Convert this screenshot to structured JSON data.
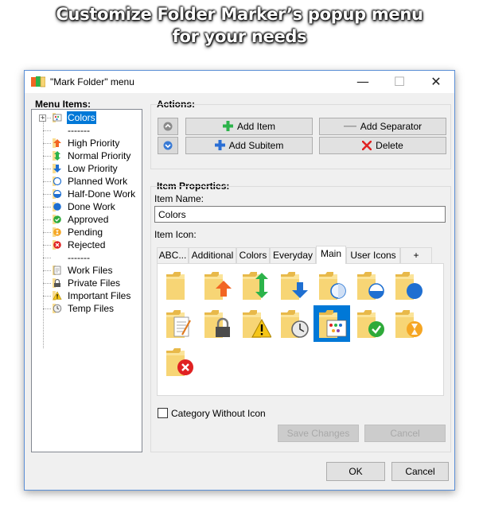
{
  "headline": {
    "line1": "Customize Folder Marker’s popup menu",
    "line2": "for your needs"
  },
  "window": {
    "title": "\"Mark Folder\" menu",
    "minimize_glyph": "—",
    "maximize_glyph": "☐",
    "close_glyph": "✕"
  },
  "menu_items": {
    "label": "Menu Items:",
    "items": [
      {
        "label": "Colors",
        "icon": "palette-icon",
        "selected": true
      },
      {
        "label": "-------",
        "icon": ""
      },
      {
        "label": "High Priority",
        "icon": "up-arrow-icon"
      },
      {
        "label": "Normal Priority",
        "icon": "up-down-arrow-icon"
      },
      {
        "label": "Low Priority",
        "icon": "down-arrow-icon"
      },
      {
        "label": "Planned Work",
        "icon": "empty-circle-icon"
      },
      {
        "label": "Half-Done Work",
        "icon": "half-circle-icon"
      },
      {
        "label": "Done Work",
        "icon": "full-circle-icon"
      },
      {
        "label": "Approved",
        "icon": "check-icon"
      },
      {
        "label": "Pending",
        "icon": "hourglass-icon"
      },
      {
        "label": "Rejected",
        "icon": "reject-icon"
      },
      {
        "label": "-------",
        "icon": ""
      },
      {
        "label": "Work Files",
        "icon": "document-icon"
      },
      {
        "label": "Private Files",
        "icon": "lock-icon"
      },
      {
        "label": "Important Files",
        "icon": "warning-icon"
      },
      {
        "label": "Temp Files",
        "icon": "clock-icon"
      }
    ]
  },
  "actions": {
    "label": "Actions:",
    "add_item": "Add Item",
    "add_separator": "Add Separator",
    "add_subitem": "Add Subitem",
    "delete": "Delete"
  },
  "item_properties": {
    "label": "Item Properties:",
    "item_name_label": "Item Name:",
    "item_name_value": "Colors",
    "item_icon_label": "Item Icon:",
    "tabs": [
      "ABC...",
      "Additional",
      "Colors",
      "Everyday",
      "Main",
      "User Icons",
      "+"
    ],
    "active_tab": "Main",
    "icons": [
      "plain-folder-icon",
      "high-priority-folder-icon",
      "normal-priority-folder-icon",
      "low-priority-folder-icon",
      "planned-folder-icon",
      "half-done-folder-icon",
      "done-folder-icon",
      "work-files-folder-icon",
      "private-folder-icon",
      "important-folder-icon",
      "temp-folder-icon",
      "palette-folder-icon",
      "approved-folder-icon",
      "pending-folder-icon",
      "rejected-folder-icon"
    ],
    "selected_icon": "palette-folder-icon",
    "category_without_icon": "Category Without Icon",
    "save_changes": "Save Changes",
    "cancel_changes": "Cancel"
  },
  "footer": {
    "ok": "OK",
    "cancel": "Cancel"
  },
  "colors": {
    "folder": "#f7d575",
    "folder_dark": "#e8b94a",
    "selection": "#0078d7",
    "orange_arrow": "#f26522",
    "green_arrow": "#2cb34a",
    "blue_arrow": "#1f6fd1",
    "red": "#e02222",
    "green_check": "#2eaa3a",
    "hourglass": "#f5a623"
  }
}
